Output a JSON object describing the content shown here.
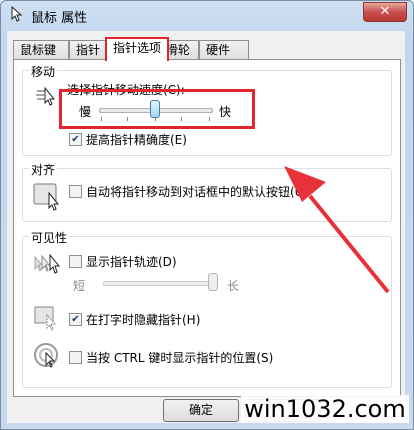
{
  "window": {
    "title": "鼠标 属性",
    "close_glyph": "✕"
  },
  "tabs": [
    {
      "label": "鼠标键",
      "active": false
    },
    {
      "label": "指针",
      "active": false
    },
    {
      "label": "指针选项",
      "active": true
    },
    {
      "label": "滑轮",
      "active": false
    },
    {
      "label": "硬件",
      "active": false
    }
  ],
  "motion": {
    "group_title": "移动",
    "speed_label": "选择指针移动速度(C):",
    "slow_label": "慢",
    "fast_label": "快",
    "speed_level": 0.5,
    "enhance_label": "提高指针精确度(E)",
    "enhance_checked": true
  },
  "snap": {
    "group_title": "对齐",
    "snap_label": "自动将指针移动到对话框中的默认按钮(U)",
    "snap_checked": false
  },
  "visibility": {
    "group_title": "可见性",
    "trails_label": "显示指针轨迹(D)",
    "trails_checked": false,
    "short_label": "短",
    "long_label": "长",
    "trails_level": 1.0,
    "hide_label": "在打字时隐藏指针(H)",
    "hide_checked": true,
    "ctrl_label": "当按 CTRL 键时显示指针的位置(S)",
    "ctrl_checked": false
  },
  "buttons": {
    "ok_label": "确定"
  },
  "watermark": {
    "text": "win1032.com"
  },
  "colors": {
    "highlight_red": "#e0262c",
    "arrow_red": "#e8323a"
  }
}
